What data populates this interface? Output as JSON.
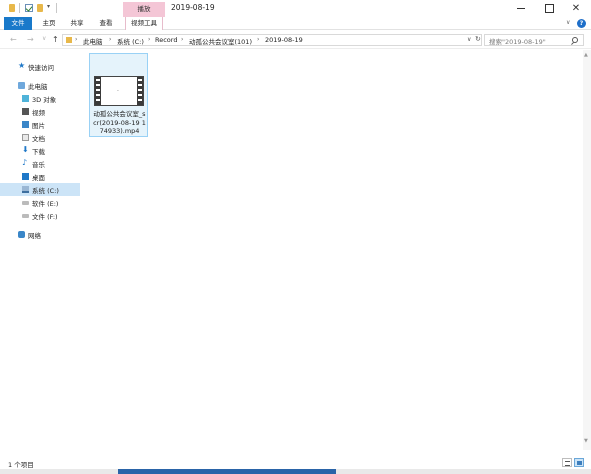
{
  "titlebar": {
    "context_tab": "播放",
    "window_title": "2019-08-19",
    "quick_access_dropdown": "▾",
    "minimize_glyph": "",
    "maximize_glyph": "",
    "close_glyph": "✕"
  },
  "ribbon": {
    "tabs": [
      {
        "label": "文件"
      },
      {
        "label": "主页"
      },
      {
        "label": "共享"
      },
      {
        "label": "查看"
      },
      {
        "label": "视频工具"
      }
    ],
    "collapse_glyph": "∨",
    "help_glyph": "?"
  },
  "nav": {
    "back": "←",
    "forward": "→",
    "recent": "∨",
    "up": "↑"
  },
  "address": {
    "root_sep": "›",
    "crumbs": [
      "此电脑",
      "系统 (C:)",
      "Record",
      "动孤公共会议室(101)",
      "2019-08-19"
    ],
    "sep": "›",
    "dropdown": "∨",
    "refresh": "↻"
  },
  "search": {
    "placeholder": "搜索\"2019-08-19\""
  },
  "navpane": {
    "items": [
      {
        "label": "快速访问"
      },
      {
        "label": "此电脑"
      },
      {
        "label": "3D 对象"
      },
      {
        "label": "视频"
      },
      {
        "label": "图片"
      },
      {
        "label": "文档"
      },
      {
        "label": "下载"
      },
      {
        "label": "音乐"
      },
      {
        "label": "桌面"
      },
      {
        "label": "系统 (C:)"
      },
      {
        "label": "软件 (E:)"
      },
      {
        "label": "文件 (F:)"
      },
      {
        "label": "网络"
      }
    ]
  },
  "files": [
    {
      "name": "动孤公共会议室_scr(2019-08-19 174933).mp4",
      "thumb_mark": "-"
    }
  ],
  "status": {
    "item_count": "1 个项目"
  },
  "scroll": {
    "up": "▲",
    "down": "▼"
  },
  "colors": {
    "file_tab": "#1979ca",
    "context_tab": "#f4c6d6",
    "selection": "#cce4f7",
    "folder": "#e8b84a"
  }
}
